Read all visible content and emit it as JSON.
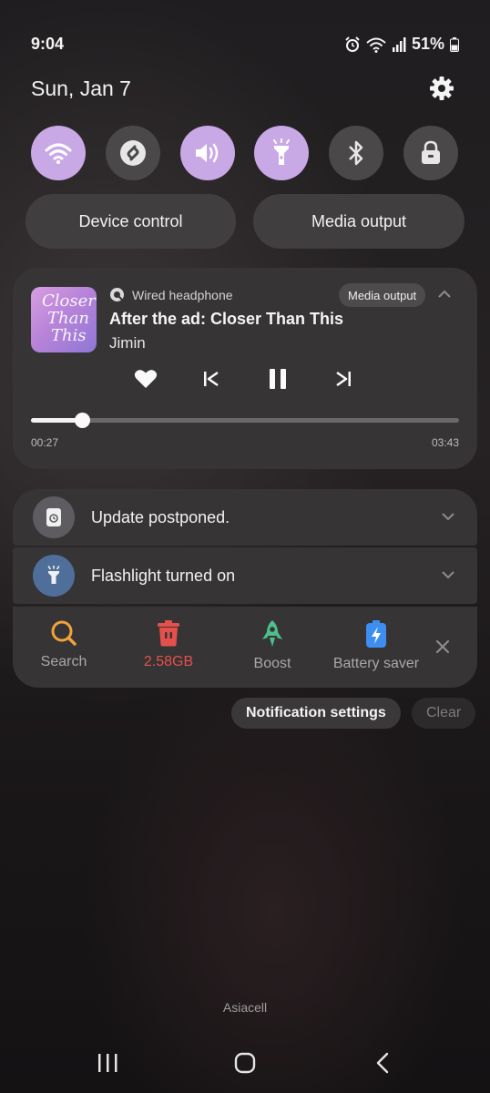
{
  "status_bar": {
    "time": "9:04",
    "battery": "51%"
  },
  "header": {
    "date": "Sun, Jan 7"
  },
  "quick_settings": [
    {
      "name": "wifi",
      "icon": "wifi-icon",
      "state": "on"
    },
    {
      "name": "shazam",
      "icon": "shazam-icon",
      "state": "off"
    },
    {
      "name": "sound",
      "icon": "sound-icon",
      "state": "on"
    },
    {
      "name": "flashlight",
      "icon": "flashlight-icon",
      "state": "on"
    },
    {
      "name": "bluetooth",
      "icon": "bluetooth-icon",
      "state": "off"
    },
    {
      "name": "lock",
      "icon": "lock-icon",
      "state": "off"
    }
  ],
  "buttons": {
    "device_control": "Device control",
    "media_output": "Media output"
  },
  "media": {
    "source": "Wired headphone",
    "output_button": "Media output",
    "album_art_text": [
      "Closer",
      "Than",
      "This"
    ],
    "title": "After the ad: Closer Than This",
    "artist": "Jimin",
    "current_time": "00:27",
    "total_time": "03:43",
    "progress": 0.12
  },
  "notifications": [
    {
      "text": "Update postponed.",
      "icon": "update-icon",
      "color": "#5e5c61"
    },
    {
      "text": "Flashlight turned on",
      "icon": "flashlight-icon",
      "color": "#4f6f9a"
    }
  ],
  "tools": [
    {
      "label": "Search",
      "icon": "search-icon",
      "color": "#f2a23a"
    },
    {
      "label": "2.58GB",
      "icon": "trash-icon",
      "color": "#e5504d"
    },
    {
      "label": "Boost",
      "icon": "rocket-icon",
      "color": "#4cc08a"
    },
    {
      "label": "Battery saver",
      "icon": "battery-saver-icon",
      "color": "#3e8ef2"
    }
  ],
  "footer": {
    "notification_settings": "Notification settings",
    "clear": "Clear",
    "carrier": "Asiacell"
  }
}
